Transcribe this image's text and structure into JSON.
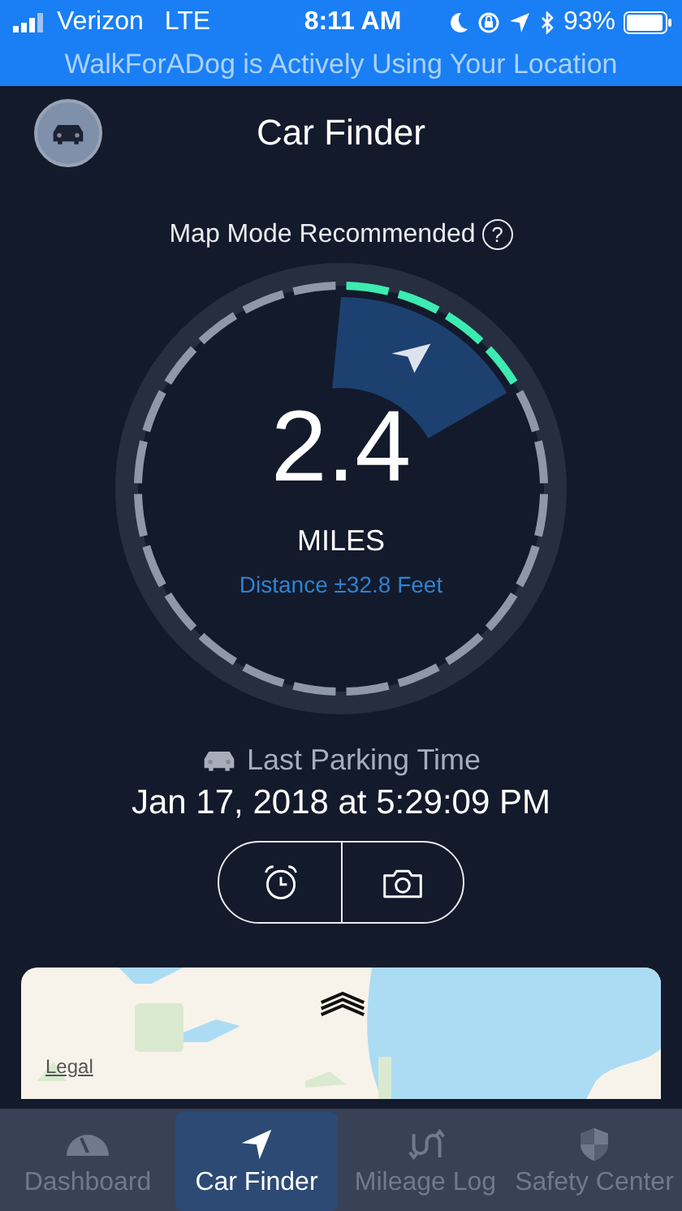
{
  "status_bar": {
    "carrier": "Verizon",
    "network": "LTE",
    "time": "8:11 AM",
    "battery": "93%"
  },
  "banner": {
    "text": "WalkForADog is Actively Using Your Location"
  },
  "header": {
    "title": "Car Finder"
  },
  "map_mode": {
    "label": "Map Mode Recommended",
    "help": "?"
  },
  "gauge": {
    "distance": "2.4",
    "unit": "MILES",
    "accuracy": "Distance ±32.8 Feet"
  },
  "parking": {
    "label": "Last Parking Time",
    "time": "Jan 17, 2018 at 5:29:09 PM"
  },
  "map": {
    "legal": "Legal"
  },
  "tabs": [
    {
      "label": "Dashboard",
      "kind": "gauge",
      "selected": false
    },
    {
      "label": "Car Finder",
      "kind": "arrow",
      "selected": true
    },
    {
      "label": "Mileage Log",
      "kind": "route",
      "selected": false
    },
    {
      "label": "Safety Center",
      "kind": "shield",
      "selected": false
    }
  ]
}
